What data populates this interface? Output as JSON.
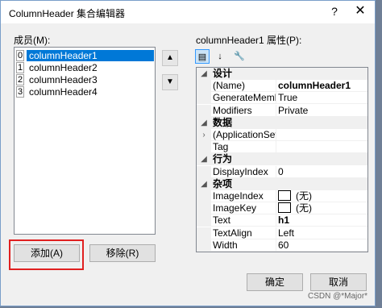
{
  "title": "ColumnHeader 集合编辑器",
  "help_glyph": "?",
  "close_glyph": "✕",
  "members_label": "成员(M):",
  "members": [
    {
      "index": "0",
      "name": "columnHeader1",
      "selected": true
    },
    {
      "index": "1",
      "name": "columnHeader2",
      "selected": false
    },
    {
      "index": "2",
      "name": "columnHeader3",
      "selected": false
    },
    {
      "index": "3",
      "name": "columnHeader4",
      "selected": false
    }
  ],
  "move_up_glyph": "▲",
  "move_down_glyph": "▼",
  "add_label": "添加(A)",
  "remove_label": "移除(R)",
  "properties_label": "columnHeader1 属性(P):",
  "toolbar": {
    "categorized_glyph": "▤",
    "alphabetical_glyph": "↓",
    "property_pages_glyph": "🔧"
  },
  "properties": [
    {
      "kind": "cat",
      "name": "设计"
    },
    {
      "kind": "prop",
      "name": "(Name)",
      "value": "columnHeader1",
      "bold": true
    },
    {
      "kind": "prop",
      "name": "GenerateMember",
      "value": "True"
    },
    {
      "kind": "prop",
      "name": "Modifiers",
      "value": "Private"
    },
    {
      "kind": "cat",
      "name": "数据"
    },
    {
      "kind": "prop",
      "name": "(ApplicationSettings)",
      "value": "",
      "expand": true
    },
    {
      "kind": "prop",
      "name": "Tag",
      "value": ""
    },
    {
      "kind": "cat",
      "name": "行为"
    },
    {
      "kind": "prop",
      "name": "DisplayIndex",
      "value": "0"
    },
    {
      "kind": "cat",
      "name": "杂项"
    },
    {
      "kind": "prop",
      "name": "ImageIndex",
      "value": "(无)",
      "swatch": true
    },
    {
      "kind": "prop",
      "name": "ImageKey",
      "value": "(无)",
      "swatch": true
    },
    {
      "kind": "prop",
      "name": "Text",
      "value": "h1",
      "bold": true
    },
    {
      "kind": "prop",
      "name": "TextAlign",
      "value": "Left"
    },
    {
      "kind": "prop",
      "name": "Width",
      "value": "60"
    }
  ],
  "ok_label": "确定",
  "cancel_label": "取消",
  "watermark": "CSDN @*Major*"
}
